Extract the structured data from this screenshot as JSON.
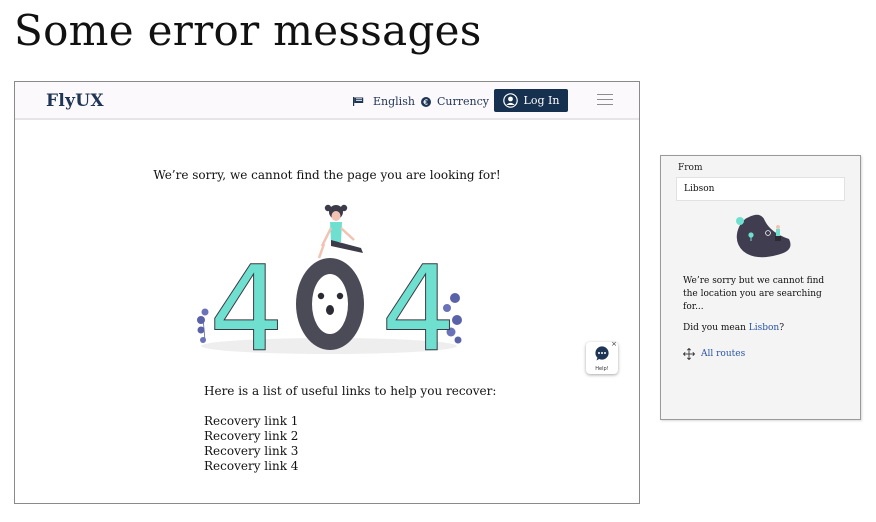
{
  "page": {
    "title": "Some error messages"
  },
  "navbar": {
    "brand": "FlyUX",
    "language_label": "English",
    "currency_label": "Currency",
    "login_label": "Log In"
  },
  "error_page": {
    "message": "We’re sorry, we cannot find the page you are looking for!",
    "illustration_text": "404",
    "help_label": "Help!",
    "help_close": "×",
    "links_heading": "Here is a list of useful links to help you recover:",
    "links": [
      "Recovery link 1",
      "Recovery link 2",
      "Recovery link 3",
      "Recovery link 4"
    ]
  },
  "location_panel": {
    "from_label": "From",
    "from_value": "Libson",
    "message": "We’re sorry but we cannot find the location you are searching for...",
    "did_you_mean_prefix": "Did you mean ",
    "suggestion": "Lisbon",
    "did_you_mean_suffix": "?",
    "all_routes_label": "All routes"
  },
  "colors": {
    "brand": "#1f3556",
    "button": "#16304f",
    "digits": "#6fe0cf",
    "link": "#2b55a8"
  }
}
